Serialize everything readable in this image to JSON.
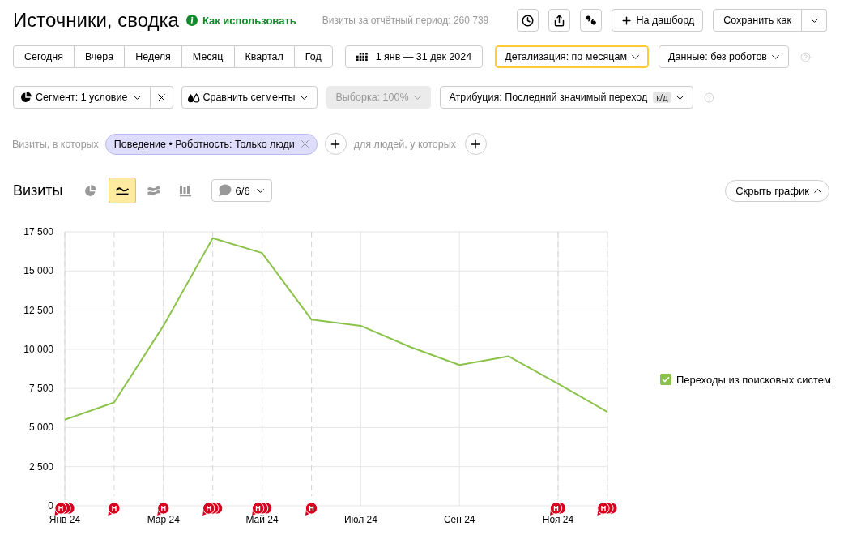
{
  "header": {
    "title": "Источники, сводка",
    "help_link": "Как использовать",
    "visits_summary": "Визиты за отчётный период: 260 739",
    "tool_buttons": [
      {
        "kind": "history"
      },
      {
        "kind": "export"
      },
      {
        "kind": "feedback"
      }
    ],
    "dashboard_button": "На дашборд",
    "save_button": "Сохранить как"
  },
  "period_bar": {
    "periods": [
      {
        "label": "Сегодня",
        "selected": false
      },
      {
        "label": "Вчера",
        "selected": false
      },
      {
        "label": "Неделя",
        "selected": false
      },
      {
        "label": "Месяц",
        "selected": false
      },
      {
        "label": "Квартал",
        "selected": false
      },
      {
        "label": "Год",
        "selected": false
      }
    ],
    "date_range": "1 янв — 31 дек 2024",
    "detail_dropdown": {
      "label": "Детализация: по месяцам",
      "active": true
    },
    "data_dropdown": {
      "label": "Данные: без роботов",
      "active": false
    }
  },
  "segment_bar": {
    "segment_dropdown": "Сегмент: 1 условие",
    "compare_dropdown": "Сравнить сегменты",
    "sample_dropdown": {
      "label": "Выборка: 100%",
      "disabled": true
    },
    "attribution_dropdown": {
      "label": "Атрибуция: Последний значимый переход",
      "badge": "к/д"
    }
  },
  "filter_bar": {
    "visits_label": "Визиты, в которых",
    "conditions": [
      {
        "text": "Поведение • Роботность: Только люди"
      }
    ],
    "people_label": "для людей, у которых"
  },
  "chart": {
    "title": "Визиты",
    "chart_types": [
      {
        "kind": "pie",
        "selected": false
      },
      {
        "kind": "line",
        "selected": true
      },
      {
        "kind": "area",
        "selected": false
      },
      {
        "kind": "bar",
        "selected": false
      }
    ],
    "notes_filter": "6/6",
    "hide_button": "Скрыть график",
    "legend": [
      {
        "checked": true
      }
    ],
    "note_markers": [
      {
        "kind": "triple"
      },
      {
        "kind": "single"
      },
      {
        "kind": "single"
      },
      {
        "kind": "triple"
      },
      {
        "kind": "triple"
      },
      {
        "kind": "single"
      },
      {
        "kind": "none"
      },
      {
        "kind": "none"
      },
      {
        "kind": "none"
      },
      {
        "kind": "none"
      },
      {
        "kind": "double"
      },
      {
        "kind": "triple"
      }
    ],
    "chart_data": {
      "type": "line",
      "grid": true,
      "categories": [
        "Янв 24",
        null,
        "Мар 24",
        null,
        "Май 24",
        null,
        "Июл 24",
        null,
        "Сен 24",
        null,
        "Ноя 24",
        null
      ],
      "ylim": [
        0,
        17500
      ],
      "yticks": [
        {
          "value": 0,
          "label": "0"
        },
        {
          "value": 2500,
          "label": "2 500"
        },
        {
          "value": 5000,
          "label": "5 000"
        },
        {
          "value": 7500,
          "label": "7 500"
        },
        {
          "value": 10000,
          "label": "10 000"
        },
        {
          "value": 12500,
          "label": "12 500"
        },
        {
          "value": 15000,
          "label": "15 000"
        },
        {
          "value": 17500,
          "label": "17 500"
        }
      ],
      "series": [
        {
          "name": "Переходы из поисковых систем",
          "color": "#8bc34a",
          "values": [
            5500,
            6600,
            11500,
            17100,
            16150,
            11900,
            11500,
            10150,
            9000,
            9550,
            7800,
            6000
          ]
        }
      ],
      "annotations": [
        "Н",
        "Н",
        "Н",
        "Н",
        "Н",
        "Н",
        "Н",
        "Н"
      ]
    }
  }
}
